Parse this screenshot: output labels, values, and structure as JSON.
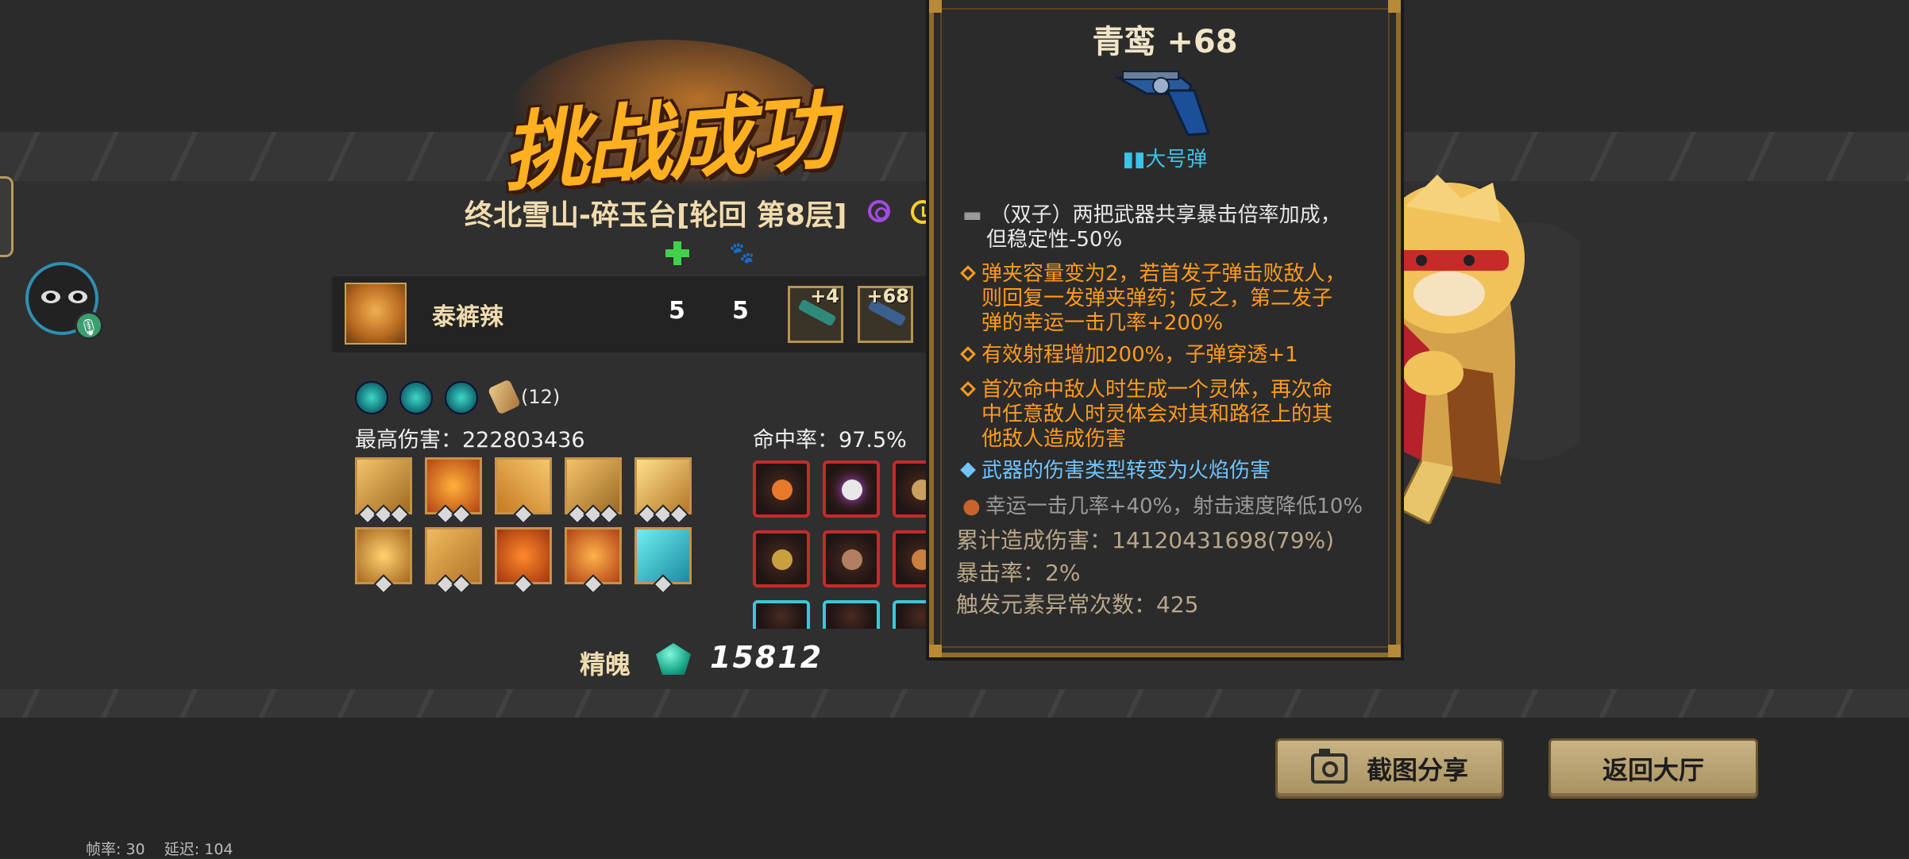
{
  "title": "挑战成功",
  "stage": "终北雪山-碎玉台[轮回  第8层]",
  "player": {
    "name": "泰裤辣",
    "stat_a": "5",
    "stat_b": "5",
    "weapons": [
      {
        "level": "+4"
      },
      {
        "level": "+68"
      }
    ]
  },
  "scroll_count": "(12)",
  "max_damage": "最高伤害：222803436",
  "hit_rate": "命中率：97.5%",
  "essence": {
    "label": "精魄",
    "value": "15812"
  },
  "tooltip": {
    "title": "青鸾 +68",
    "ammo": "大号弹",
    "twin_effect": "（双子）两把武器共享暴击倍率加成，",
    "twin_effect_2": "但稳定性-50%",
    "traits": [
      {
        "line1": "弹夹容量变为2，若首发子弹击败敌人，",
        "line2": "则回复一发弹夹弹药；反之，第二发子",
        "line3": "弹的幸运一击几率+200%"
      },
      {
        "line1": "有效射程增加200%，子弹穿透+1"
      },
      {
        "line1": "首次命中敌人时生成一个灵体，再次命",
        "line2": "中任意敌人时灵体会对其和路径上的其",
        "line3": "他敌人造成伤害"
      },
      {
        "line1": "武器的伤害类型转变为火焰伤害"
      }
    ],
    "luck_line": "幸运一击几率+40%，射击速度降低10%",
    "total_damage": "累计造成伤害：14120431698(79%)",
    "crit_rate": "暴击率：2%",
    "element_triggers": "触发元素异常次数：425"
  },
  "buttons": {
    "share": "截图分享",
    "lobby": "返回大厅"
  },
  "debug": {
    "fps": "帧率: 30",
    "latency": "延迟: 104"
  },
  "colors": {
    "accent_gold": "#c8a15a",
    "orange_trait": "#ff9b1c",
    "blue_trait": "#6fc4ff",
    "ammo_cyan": "#3dc3e8"
  },
  "icons": [
    "swirl-icon",
    "clock-icon",
    "heal-cross-icon",
    "pet-icon",
    "mic-icon",
    "camera-icon",
    "gem-icon"
  ]
}
